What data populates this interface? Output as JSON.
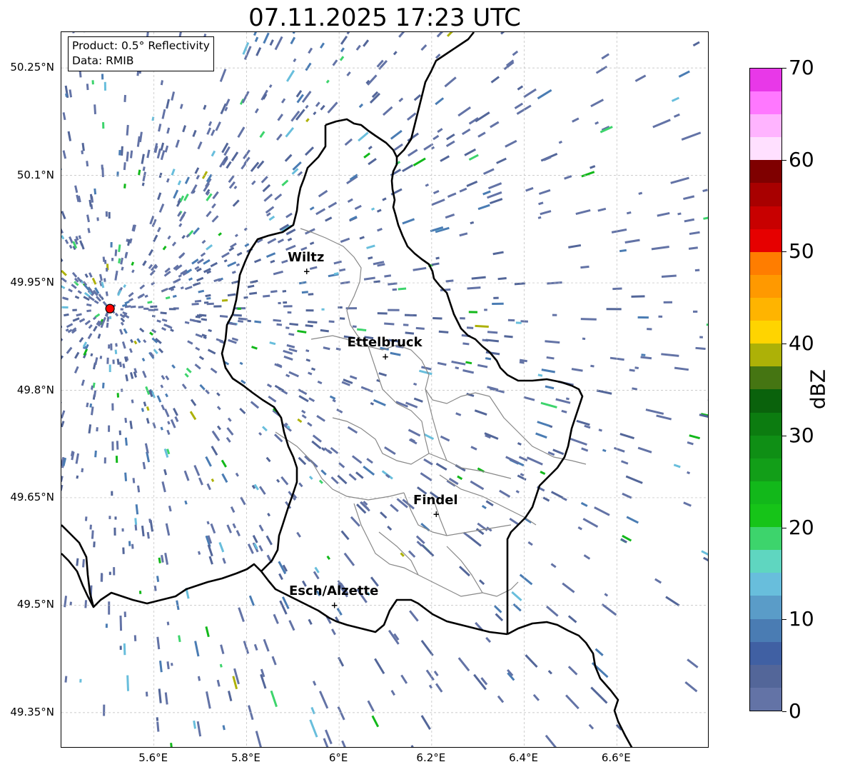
{
  "title": "07.11.2025 17:23 UTC",
  "info": {
    "product": "Product: 0.5° Reflectivity",
    "data_source": "Data: RMIB"
  },
  "map": {
    "lon_range": [
      5.4,
      6.8
    ],
    "lat_range": [
      49.3,
      50.3
    ],
    "lat_ticks": [
      "50.25°N",
      "50.1°N",
      "49.95°N",
      "49.8°N",
      "49.65°N",
      "49.5°N",
      "49.35°N"
    ],
    "lon_ticks": [
      "5.6°E",
      "5.8°E",
      "6°E",
      "6.2°E",
      "6.4°E",
      "6.6°E"
    ],
    "radar_site": {
      "lon": 5.505,
      "lat": 49.914,
      "color": "#ff0000"
    },
    "cities": [
      {
        "name": "Wiltz",
        "lon": 5.93,
        "lat": 49.966
      },
      {
        "name": "Ettelbruck",
        "lon": 6.1,
        "lat": 49.847
      },
      {
        "name": "Findel",
        "lon": 6.21,
        "lat": 49.627
      },
      {
        "name": "Esch/Alzette",
        "lon": 5.99,
        "lat": 49.5
      }
    ]
  },
  "colorbar": {
    "label": "dBZ",
    "min": 0,
    "max": 70,
    "ticks": [
      "0",
      "10",
      "20",
      "30",
      "40",
      "50",
      "60",
      "70"
    ],
    "colors": [
      "#6373a6",
      "#536699",
      "#4060a3",
      "#4a7cb3",
      "#5a9cc8",
      "#68bedc",
      "#5fd6c0",
      "#3dd46c",
      "#16c418",
      "#12b81a",
      "#129e18",
      "#0f8f15",
      "#0c7c10",
      "#0a620c",
      "#457512",
      "#adb107",
      "#ffd400",
      "#ffb400",
      "#ff9900",
      "#ff7d00",
      "#e60000",
      "#c80000",
      "#a80000",
      "#7f0000",
      "#ffe0ff",
      "#ffb4ff",
      "#ff78ff",
      "#e838e8"
    ]
  }
}
